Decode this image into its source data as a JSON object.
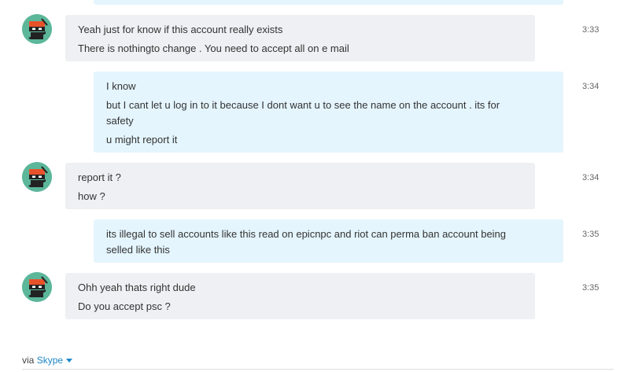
{
  "messages": [
    {
      "from": "them",
      "time": "3:33",
      "lines": [
        "Yeah just for know if this account really exists",
        "There is nothingto change . You need to accept all on e mail"
      ]
    },
    {
      "from": "me",
      "time": "3:34",
      "lines": [
        "I know",
        "but I cant let u log in to it because I dont want u to see the name on the account . its for",
        "safety",
        "u might report it"
      ]
    },
    {
      "from": "them",
      "time": "3:34",
      "lines": [
        "report it ?",
        "how ?"
      ]
    },
    {
      "from": "me",
      "time": "3:35",
      "lines": [
        "its illegal to sell accounts like this read on epicnpc and riot can perma ban account being",
        "selled like this"
      ]
    },
    {
      "from": "them",
      "time": "3:35",
      "lines": [
        "Ohh yeah thats right dude",
        "Do you accept psc ?"
      ]
    }
  ],
  "footer": {
    "via": "via",
    "service": "Skype"
  },
  "icons": {
    "avatar": "ninja-avatar-icon",
    "dropdown": "chevron-down-icon"
  },
  "colors": {
    "incoming_bubble": "#eef0f3",
    "outgoing_bubble": "#e4f5fd",
    "avatar_bg": "#5cb79a",
    "link": "#1e88c8"
  }
}
